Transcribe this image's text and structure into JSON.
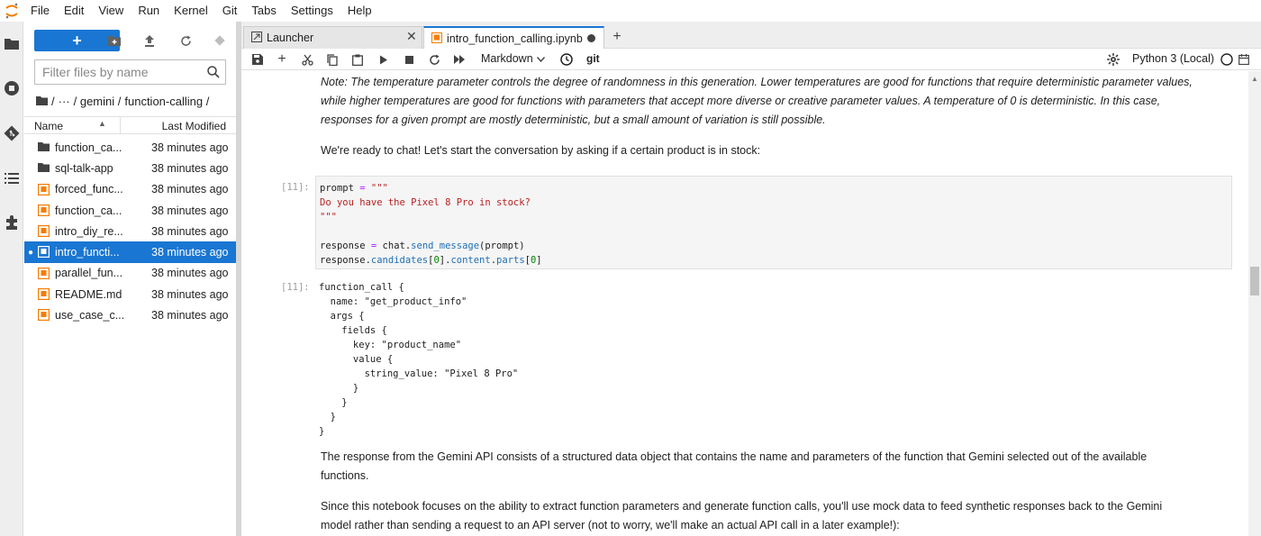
{
  "menu": [
    "File",
    "Edit",
    "View",
    "Run",
    "Kernel",
    "Git",
    "Tabs",
    "Settings",
    "Help"
  ],
  "filebrowser": {
    "new_label": "+",
    "filter_placeholder": "Filter files by name",
    "breadcrumb": [
      "/",
      "···",
      "/ gemini /",
      "function-calling /"
    ],
    "col_name": "Name",
    "col_modified": "Last Modified",
    "files": [
      {
        "name": "function_ca...",
        "modified": "38 minutes ago",
        "kind": "folder",
        "selected": false
      },
      {
        "name": "sql-talk-app",
        "modified": "38 minutes ago",
        "kind": "folder",
        "selected": false
      },
      {
        "name": "forced_func...",
        "modified": "38 minutes ago",
        "kind": "notebook",
        "selected": false
      },
      {
        "name": "function_ca...",
        "modified": "38 minutes ago",
        "kind": "notebook",
        "selected": false
      },
      {
        "name": "intro_diy_re...",
        "modified": "38 minutes ago",
        "kind": "notebook",
        "selected": false
      },
      {
        "name": "intro_functi...",
        "modified": "38 minutes ago",
        "kind": "notebook",
        "selected": true
      },
      {
        "name": "parallel_fun...",
        "modified": "38 minutes ago",
        "kind": "notebook",
        "selected": false
      },
      {
        "name": "README.md",
        "modified": "38 minutes ago",
        "kind": "markdown",
        "selected": false
      },
      {
        "name": "use_case_c...",
        "modified": "38 minutes ago",
        "kind": "notebook",
        "selected": false
      }
    ]
  },
  "tabs": [
    {
      "label": "Launcher",
      "active": false
    },
    {
      "label": "intro_function_calling.ipynb",
      "active": true
    }
  ],
  "toolbar": {
    "cell_type": "Markdown",
    "git_label": "git",
    "kernel": "Python 3 (Local)"
  },
  "notebook": {
    "note_lines": [
      "Note: The temperature parameter controls the degree of randomness in this generation. Lower temperatures are good for functions that require deterministic parameter values,",
      "while higher temperatures are good for functions with parameters that accept more diverse or creative parameter values. A temperature of 0 is deterministic. In this case,",
      "responses for a given prompt are mostly deterministic, but a small amount of variation is still possible."
    ],
    "ready_text": "We're ready to chat! Let's start the conversation by asking if a certain product is in stock:",
    "input_prompt": "[11]:",
    "output_prompt": "[11]:",
    "code": {
      "l1_var": "prompt",
      "l1_op": " = ",
      "l1_str": "\"\"\"",
      "l2_str": "Do you have the Pixel 8 Pro in stock?",
      "l3_str": "\"\"\"",
      "l5_a": "response ",
      "l5_op": "=",
      "l5_b": " chat.",
      "l5_attr": "send_message",
      "l5_c": "(prompt)",
      "l6_a": "response.",
      "l6_attr1": "candidates",
      "l6_b": "[",
      "l6_num1": "0",
      "l6_c": "].",
      "l6_attr2": "content",
      "l6_d": ".",
      "l6_attr3": "parts",
      "l6_e": "[",
      "l6_num2": "0",
      "l6_f": "]"
    },
    "output_lines": [
      "function_call {",
      "  name: \"get_product_info\"",
      "  args {",
      "    fields {",
      "      key: \"product_name\"",
      "      value {",
      "        string_value: \"Pixel 8 Pro\"",
      "      }",
      "    }",
      "  }",
      "}"
    ],
    "response_lines": [
      "The response from the Gemini API consists of a structured data object that contains the name and parameters of the function that Gemini selected out of the available",
      "functions."
    ],
    "mock_lines": [
      "Since this notebook focuses on the ability to extract function parameters and generate function calls, you'll use mock data to feed synthetic responses back to the Gemini",
      "model rather than sending a request to an API server (not to worry, we'll make an actual API call in a later example!):"
    ]
  },
  "colors": {
    "accent": "#1976d2",
    "notebook_icon": "#f57c00",
    "string": "#ba2121",
    "attr": "#1f6fb5"
  }
}
